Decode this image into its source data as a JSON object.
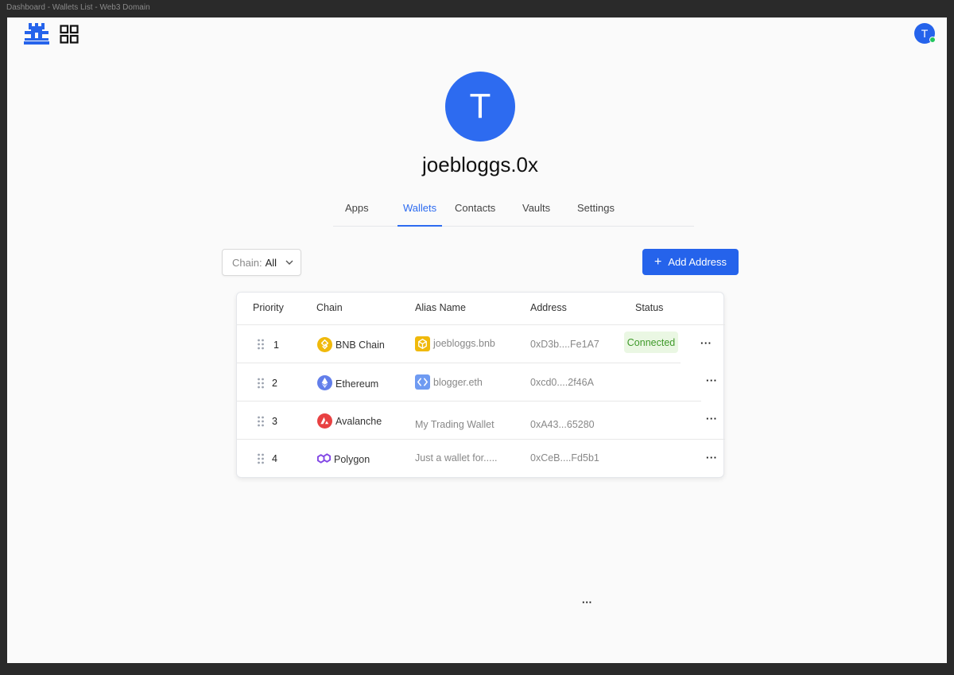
{
  "window": {
    "title": "Dashboard - Wallets List - Web3 Domain"
  },
  "header": {
    "avatar_initial": "T"
  },
  "profile": {
    "avatar_initial": "T",
    "username": "joebloggs.0x"
  },
  "tabs": [
    {
      "label": "Apps",
      "active": false
    },
    {
      "label": "Wallets",
      "active": true
    },
    {
      "label": "Contacts",
      "active": false
    },
    {
      "label": "Vaults",
      "active": false
    },
    {
      "label": "Settings",
      "active": false
    }
  ],
  "filter": {
    "label": "Chain:",
    "value": "All"
  },
  "add_button": {
    "icon": "plus-icon",
    "label": "Add Address"
  },
  "table": {
    "columns": [
      "Priority",
      "Chain",
      "Alias Name",
      "Address",
      "Status"
    ],
    "rows": [
      {
        "priority": "1",
        "chain": "BNB Chain",
        "chain_icon": "bnb-icon",
        "alias": "joebloggs.bnb",
        "alias_icon": "bnb-domain-icon",
        "address": "0xD3b....Fe1A7",
        "status": "Connected",
        "more": "···"
      },
      {
        "priority": "2",
        "chain": "Ethereum",
        "chain_icon": "ethereum-icon",
        "alias": "blogger.eth",
        "alias_icon": "ens-icon",
        "address": "0xcd0....2f46A",
        "status": "",
        "more": "···"
      },
      {
        "priority": "3",
        "chain": "Avalanche",
        "chain_icon": "avalanche-icon",
        "alias": "My Trading Wallet",
        "alias_icon": "",
        "address": "0xA43...65280",
        "status": "",
        "more": "···"
      },
      {
        "priority": "4",
        "chain": "Polygon",
        "chain_icon": "polygon-icon",
        "alias": "Just a wallet for.....",
        "alias_icon": "",
        "address": "0xCeB....Fd5b1",
        "status": "",
        "more": "···"
      }
    ]
  },
  "stray_more": "···",
  "colors": {
    "accent": "#2563eb",
    "connected_bg": "#eaf7e3",
    "connected_text": "#3f9a2a",
    "bnb": "#F0B90B",
    "ethereum": "#627EEA",
    "avalanche": "#E84142",
    "polygon": "#8247E5"
  }
}
